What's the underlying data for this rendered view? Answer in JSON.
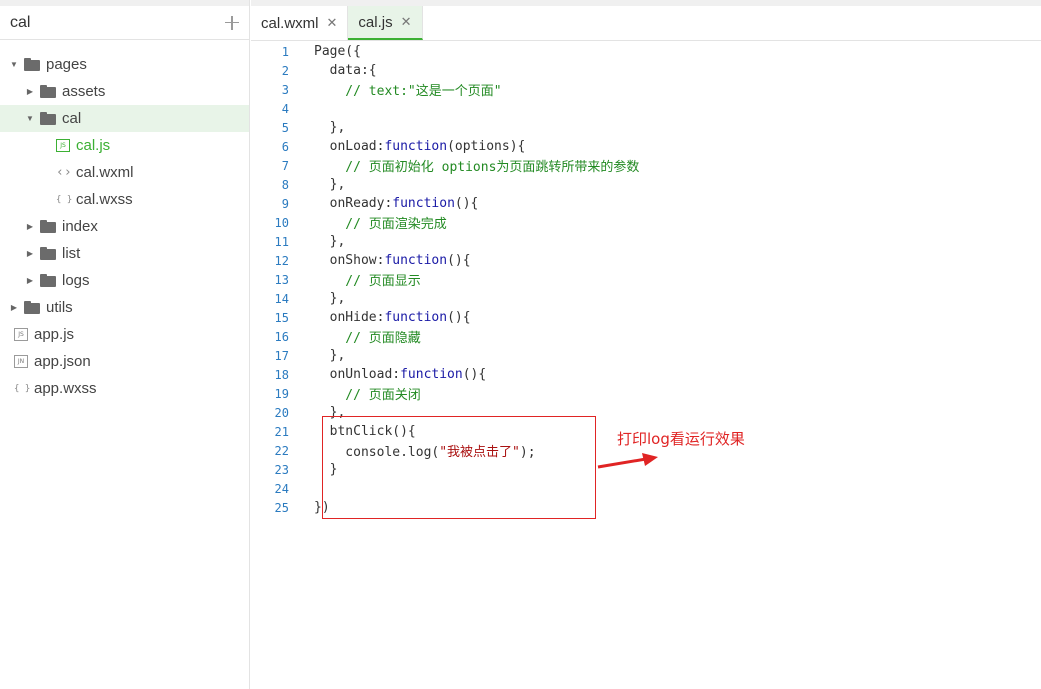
{
  "sidebar": {
    "title": "cal",
    "tree": [
      {
        "label": "pages",
        "type": "folder",
        "open": true,
        "depth": 0
      },
      {
        "label": "assets",
        "type": "folder",
        "open": false,
        "depth": 1
      },
      {
        "label": "cal",
        "type": "folder",
        "open": true,
        "depth": 1,
        "selected": true
      },
      {
        "label": "cal.js",
        "type": "js",
        "depth": 2,
        "active": true
      },
      {
        "label": "cal.wxml",
        "type": "wxml",
        "depth": 2
      },
      {
        "label": "cal.wxss",
        "type": "wxss",
        "depth": 2
      },
      {
        "label": "index",
        "type": "folder",
        "open": false,
        "depth": 1
      },
      {
        "label": "list",
        "type": "folder",
        "open": false,
        "depth": 1
      },
      {
        "label": "logs",
        "type": "folder",
        "open": false,
        "depth": 1
      },
      {
        "label": "utils",
        "type": "folder",
        "open": false,
        "depth": 0
      },
      {
        "label": "app.js",
        "type": "js",
        "depth": 0
      },
      {
        "label": "app.json",
        "type": "json",
        "depth": 0
      },
      {
        "label": "app.wxss",
        "type": "wxss",
        "depth": 0
      }
    ]
  },
  "tabs": [
    {
      "label": "cal.wxml",
      "active": false
    },
    {
      "label": "cal.js",
      "active": true
    }
  ],
  "icons": {
    "js": "JS",
    "json": "JN"
  },
  "code_lines": [
    [
      {
        "t": "Page({",
        "c": ""
      }
    ],
    [
      {
        "t": "  data:{",
        "c": ""
      }
    ],
    [
      {
        "t": "    // text:\"这是一个页面\"",
        "c": "cm"
      }
    ],
    [
      {
        "t": "",
        "c": ""
      }
    ],
    [
      {
        "t": "  },",
        "c": ""
      }
    ],
    [
      {
        "t": "  onLoad:",
        "c": ""
      },
      {
        "t": "function",
        "c": "kw"
      },
      {
        "t": "(options){",
        "c": ""
      }
    ],
    [
      {
        "t": "    // 页面初始化 options为页面跳转所带来的参数",
        "c": "cm"
      }
    ],
    [
      {
        "t": "  },",
        "c": ""
      }
    ],
    [
      {
        "t": "  onReady:",
        "c": ""
      },
      {
        "t": "function",
        "c": "kw"
      },
      {
        "t": "(){",
        "c": ""
      }
    ],
    [
      {
        "t": "    // 页面渲染完成",
        "c": "cm"
      }
    ],
    [
      {
        "t": "  },",
        "c": ""
      }
    ],
    [
      {
        "t": "  onShow:",
        "c": ""
      },
      {
        "t": "function",
        "c": "kw"
      },
      {
        "t": "(){",
        "c": ""
      }
    ],
    [
      {
        "t": "    // 页面显示",
        "c": "cm"
      }
    ],
    [
      {
        "t": "  },",
        "c": ""
      }
    ],
    [
      {
        "t": "  onHide:",
        "c": ""
      },
      {
        "t": "function",
        "c": "kw"
      },
      {
        "t": "(){",
        "c": ""
      }
    ],
    [
      {
        "t": "    // 页面隐藏",
        "c": "cm"
      }
    ],
    [
      {
        "t": "  },",
        "c": ""
      }
    ],
    [
      {
        "t": "  onUnload:",
        "c": ""
      },
      {
        "t": "function",
        "c": "kw"
      },
      {
        "t": "(){",
        "c": ""
      }
    ],
    [
      {
        "t": "    // 页面关闭",
        "c": "cm"
      }
    ],
    [
      {
        "t": "  },",
        "c": ""
      }
    ],
    [
      {
        "t": "  btnClick(){",
        "c": ""
      }
    ],
    [
      {
        "t": "    console.log(",
        "c": ""
      },
      {
        "t": "\"我被点击了\"",
        "c": "str"
      },
      {
        "t": ");",
        "c": ""
      }
    ],
    [
      {
        "t": "  }",
        "c": ""
      }
    ],
    [
      {
        "t": "",
        "c": ""
      }
    ],
    [
      {
        "t": "})",
        "c": ""
      }
    ]
  ],
  "annotation": {
    "text": "打印log看运行效果",
    "color": "#e02424"
  },
  "colors": {
    "accent": "#3cb034",
    "line_numbers": "#2b7bc0",
    "keyword": "#1a1aa6",
    "comment": "#238a23",
    "string": "#a11111"
  }
}
